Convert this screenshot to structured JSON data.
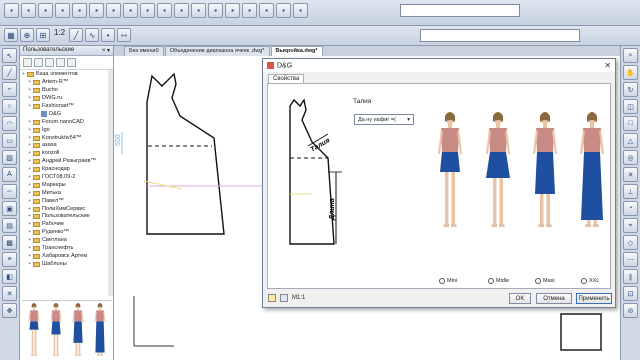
{
  "toolbar": {
    "scale_text": "1:2",
    "top_icons": [
      "A",
      "B",
      "C",
      "D",
      "E",
      "F",
      "G",
      "H",
      "I",
      "J",
      "K",
      "L",
      "M",
      "N",
      "O",
      "P",
      "Q",
      "R"
    ],
    "second_icons": [
      "a",
      "b",
      "c",
      "d",
      "e",
      "f",
      "g",
      "h",
      "i"
    ]
  },
  "tabs": [
    {
      "label": "Без имени0"
    },
    {
      "label": "Объединение диапазона ячеек .dwg*"
    },
    {
      "label": "Выкройка.dwg*"
    }
  ],
  "panel": {
    "title": "Пользовательские",
    "items": [
      {
        "label": "База элементов",
        "kind": "root"
      },
      {
        "label": "Artem-R™",
        "kind": "folder"
      },
      {
        "label": "Bucho",
        "kind": "folder"
      },
      {
        "label": "DWG.ru",
        "kind": "folder"
      },
      {
        "label": "Fashionart™",
        "kind": "folder"
      },
      {
        "label": "D&G",
        "kind": "leaf"
      },
      {
        "label": "Forum nanoCAD",
        "kind": "folder"
      },
      {
        "label": "Igo",
        "kind": "folder"
      },
      {
        "label": "Konstruktiv54™",
        "kind": "folder"
      },
      {
        "label": "азаха",
        "kind": "folder"
      },
      {
        "label": "konzoll",
        "kind": "folder"
      },
      {
        "label": "Андрей Разыграев™",
        "kind": "folder"
      },
      {
        "label": "Краснодар",
        "kind": "folder"
      },
      {
        "label": "ГОСТ08.09-2",
        "kind": "folder"
      },
      {
        "label": "Маркеры",
        "kind": "folder"
      },
      {
        "label": "Митька",
        "kind": "folder"
      },
      {
        "label": "Павел™",
        "kind": "folder"
      },
      {
        "label": "ПолиХимСервис",
        "kind": "folder"
      },
      {
        "label": "Пользовательские",
        "kind": "folder"
      },
      {
        "label": "Рабочие",
        "kind": "folder"
      },
      {
        "label": "Руденко™",
        "kind": "folder"
      },
      {
        "label": "Светлана",
        "kind": "folder"
      },
      {
        "label": "Транснефть",
        "kind": "folder"
      },
      {
        "label": "Хабаровск Артем",
        "kind": "folder"
      },
      {
        "label": "Шаблоны",
        "kind": "folder"
      }
    ]
  },
  "drawing": {
    "dim_label": "550"
  },
  "dialog": {
    "title": "D&G",
    "tab": "Свойства",
    "waist_label": "Талия",
    "combo_value": "Да ну нафиг =(",
    "sketch_waist": "Талия",
    "sketch_length": "Длина",
    "options": [
      {
        "label": "Mini"
      },
      {
        "label": "Midle"
      },
      {
        "label": "Maxi"
      },
      {
        "label": "XXL"
      }
    ],
    "scale": "М1:1",
    "ok": "OK",
    "cancel": "Отмена",
    "apply": "Применить"
  },
  "colors": {
    "skirt": "#1f4fa0",
    "top": "#c98a86",
    "skin": "#e9c3a4",
    "hair": "#8a6a3c",
    "accent": "#3a6fb5"
  }
}
